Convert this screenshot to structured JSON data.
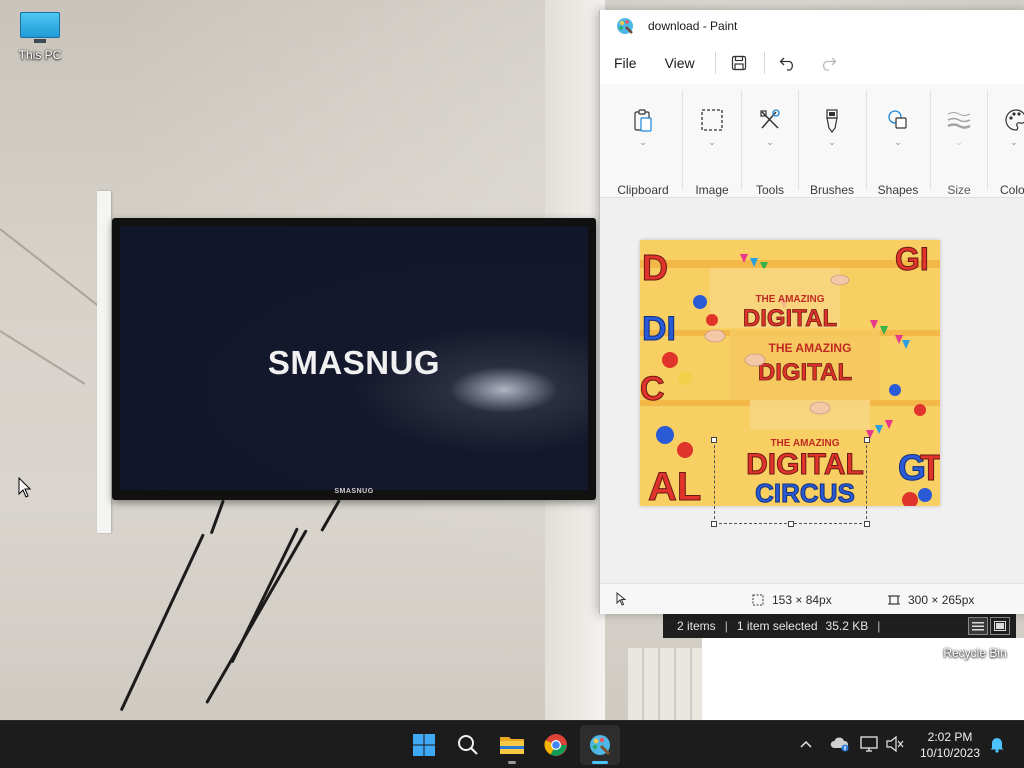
{
  "desktop": {
    "icons": [
      {
        "label": "This PC"
      },
      {
        "label": "Recycle Bin"
      }
    ],
    "wallpaper_tv": {
      "screen_text": "SMASNUG",
      "bezel_brand": "SMASNUG"
    }
  },
  "paint": {
    "title": "download - Paint",
    "menu": {
      "file": "File",
      "view": "View"
    },
    "ribbon_groups": [
      {
        "label": "Clipboard",
        "icon": "clipboard-icon"
      },
      {
        "label": "Image",
        "icon": "select-icon"
      },
      {
        "label": "Tools",
        "icon": "tools-icon"
      },
      {
        "label": "Brushes",
        "icon": "brush-icon"
      },
      {
        "label": "Shapes",
        "icon": "shapes-icon"
      },
      {
        "label": "Size",
        "icon": "size-icon"
      },
      {
        "label": "Colo",
        "icon": "palette-icon"
      }
    ],
    "canvas_image": {
      "text_main": "DIGITAL",
      "text_top": "THE AMAZING",
      "text_bottom": "CIRCUS"
    },
    "status": {
      "selection_size": "153 × 84px",
      "canvas_size": "300 × 265px"
    }
  },
  "explorer_status": {
    "items": "2 items",
    "selected": "1 item selected",
    "size": "35.2 KB",
    "separator": "|"
  },
  "taskbar": {
    "apps": [
      "start-icon",
      "search-icon",
      "file-explorer-icon",
      "chrome-icon",
      "paint-icon"
    ],
    "clock": {
      "time": "2:02 PM",
      "date": "10/10/2023"
    }
  },
  "colors": {
    "taskbar": "#1c1c1c",
    "accent": "#4cc2ff",
    "paint_bg": "#f3f3f3"
  }
}
